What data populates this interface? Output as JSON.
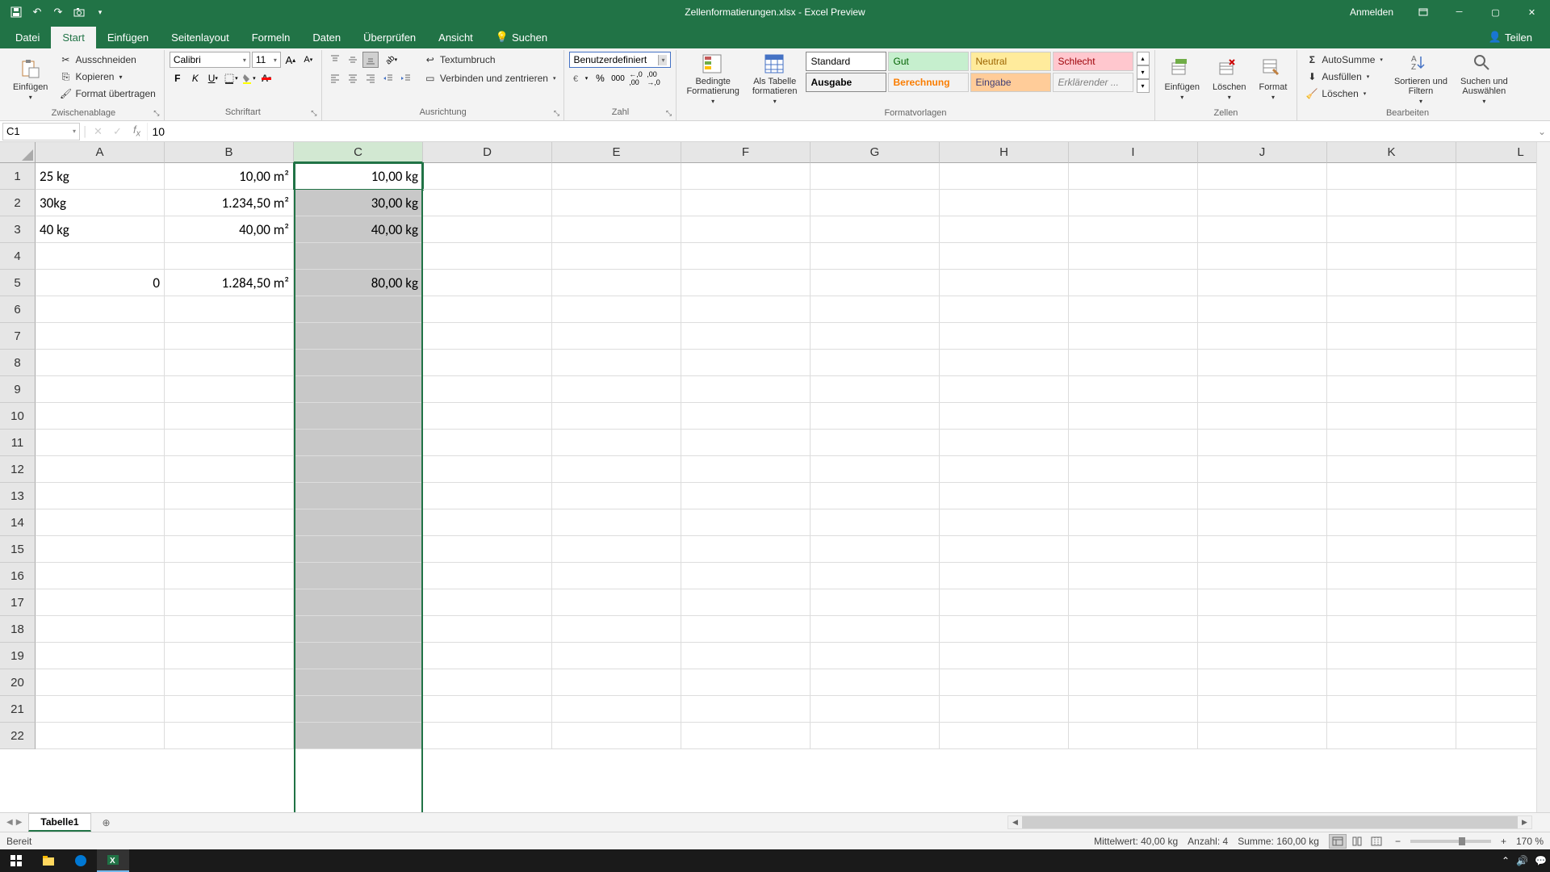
{
  "titlebar": {
    "title": "Zellenformatierungen.xlsx - Excel Preview",
    "signin": "Anmelden"
  },
  "tabs": {
    "datei": "Datei",
    "start": "Start",
    "einfugen": "Einfügen",
    "seitenlayout": "Seitenlayout",
    "formeln": "Formeln",
    "daten": "Daten",
    "uberprufen": "Überprüfen",
    "ansicht": "Ansicht",
    "suchen": "Suchen",
    "teilen": "Teilen"
  },
  "ribbon": {
    "clipboard": {
      "label": "Zwischenablage",
      "paste": "Einfügen",
      "cut": "Ausschneiden",
      "copy": "Kopieren",
      "format_painter": "Format übertragen"
    },
    "font": {
      "label": "Schriftart",
      "name": "Calibri",
      "size": "11"
    },
    "alignment": {
      "label": "Ausrichtung",
      "wrap": "Textumbruch",
      "merge": "Verbinden und zentrieren"
    },
    "number": {
      "label": "Zahl",
      "format": "Benutzerdefiniert"
    },
    "styles": {
      "label": "Formatvorlagen",
      "conditional": "Bedingte\nFormatierung",
      "table": "Als Tabelle\nformatieren",
      "standard": "Standard",
      "gut": "Gut",
      "neutral": "Neutral",
      "schlecht": "Schlecht",
      "ausgabe": "Ausgabe",
      "berechnung": "Berechnung",
      "eingabe": "Eingabe",
      "erklarender": "Erklärender ..."
    },
    "cells": {
      "label": "Zellen",
      "insert": "Einfügen",
      "delete": "Löschen",
      "format": "Format"
    },
    "editing": {
      "label": "Bearbeiten",
      "autosum": "AutoSumme",
      "fill": "Ausfüllen",
      "clear": "Löschen",
      "sort": "Sortieren und\nFiltern",
      "find": "Suchen und\nAuswählen"
    }
  },
  "namebox": "C1",
  "formula": "10",
  "columns": [
    "A",
    "B",
    "C",
    "D",
    "E",
    "F",
    "G",
    "H",
    "I",
    "J",
    "K",
    "L"
  ],
  "rows": [
    "1",
    "2",
    "3",
    "4",
    "5",
    "6",
    "7",
    "8",
    "9",
    "10",
    "11",
    "12",
    "13",
    "14",
    "15",
    "16",
    "17",
    "18",
    "19",
    "20",
    "21",
    "22"
  ],
  "data": {
    "A1": "25 kg",
    "B1": "10,00 m²",
    "C1": "10,00 kg",
    "A2": "30kg",
    "B2": "1.234,50 m²",
    "C2": "30,00 kg",
    "A3": "40 kg",
    "B3": "40,00 m²",
    "C3": "40,00 kg",
    "A5": "0",
    "B5": "1.284,50 m²",
    "C5": "80,00 kg"
  },
  "sheet": {
    "name": "Tabelle1"
  },
  "status": {
    "ready": "Bereit",
    "avg": "Mittelwert: 40,00 kg",
    "count": "Anzahl: 4",
    "sum": "Summe: 160,00 kg",
    "zoom": "170 %"
  }
}
